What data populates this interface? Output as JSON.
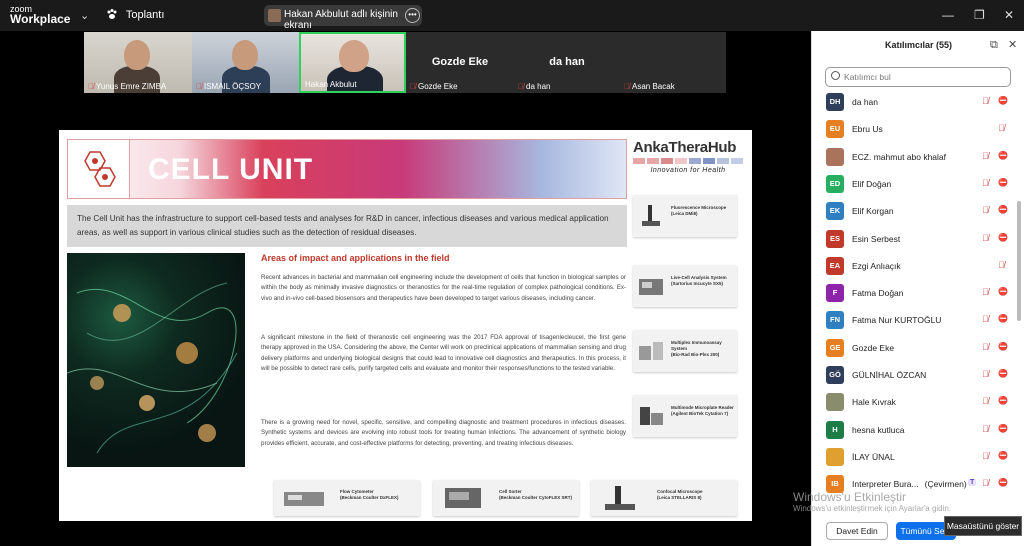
{
  "app": {
    "logo_top": "zoom",
    "logo_bottom": "Workplace",
    "meeting_label": "Toplantı"
  },
  "share": {
    "label": "Hakan Akbulut adlı kişinin ekranı"
  },
  "window_controls": {
    "minimize": "—",
    "restore": "❐",
    "close": "✕"
  },
  "video_tiles": [
    {
      "name": "Yunus Emre ZIMBA",
      "type": "camera"
    },
    {
      "name": "ISMAIL ÖÇSOY",
      "type": "camera"
    },
    {
      "name": "Hakan Akbulut",
      "type": "camera",
      "active_speaker": true
    },
    {
      "name": "Gozde Eke",
      "display": "Gozde Eke",
      "type": "name"
    },
    {
      "name": "da han",
      "display": "da han",
      "type": "name"
    },
    {
      "name": "Asan Bacak",
      "type": "name"
    }
  ],
  "slide": {
    "banner_title": "CELL UNIT",
    "brand_name": "AnkaTheraHub",
    "brand_tagline": "Innovation for Health",
    "intro": "The Cell Unit has the infrastructure to support cell-based tests and analyses for R&D in cancer, infectious diseases and various medical application areas, as well as support in various clinical studies such as the detection of residual diseases.",
    "areas_title": "Areas of impact and applications in the field",
    "para1": "Recent advances in bacterial and mammalian cell engineering include the development of cells that function in biological samples or within the body as minimally invasive diagnostics or theranostics for the real-time regulation of complex pathological conditions. Ex-vivo and in-vivo cell-based biosensors and therapeutics have been developed to target various diseases, including cancer.",
    "para2": "A significant milestone in the field of theranostic cell engineering was the 2017 FDA approval of tisagenlecleucel, the first gene therapy approved in the USA. Considering the above, the Center will work on preclinical applications of mammalian sensing and drug delivery platforms and underlying biological designs that could lead to innovative cell diagnostics and therapeutics. In this process, it will be possible to detect rare cells, purify targeted cells and evaluate and monitor their responses/functions to the tested variable.",
    "para3": "There is a growing need for novel, specific, sensitive, and compelling diagnostic and treatment procedures in infectious diseases. Synthetic systems and devices are evolving into robust tools for treating human infections. The advancement of synthetic biology provides efficient, accurate, and cost-effective platforms for detecting, preventing, and treating infectious diseases.",
    "equipment_side": [
      {
        "name": "Fluorescence Microscope",
        "model": "(Leica DMi8)"
      },
      {
        "name": "Live-Cell Analysis System",
        "model": "(Sartorius Incucyte SX5)"
      },
      {
        "name": "Multiplex Immunoassay System",
        "model": "(Bio-Rad Bio-Plex 200)"
      },
      {
        "name": "Multimode Microplate Reader",
        "model": "(Agilent BioTek Cytation 7)"
      }
    ],
    "equipment_bottom": [
      {
        "name": "Flow Cytometer",
        "model": "(Beckman Coulter DxFLEX)"
      },
      {
        "name": "Cell Sorter",
        "model": "(Beckman Coulter CytoFLEX SRT)"
      },
      {
        "name": "Confocal Microscope",
        "model": "(Leica STELLARIS 8)"
      }
    ]
  },
  "participants": {
    "title": "Katılımcılar (55)",
    "search_placeholder": "Katılımcı bul",
    "list": [
      {
        "initials": "DH",
        "name": "da han",
        "color": "#2f3e5a",
        "video_off": true
      },
      {
        "initials": "EU",
        "name": "Ebru Us",
        "color": "#e67e22",
        "video_off": false
      },
      {
        "initials": "",
        "name": "ECZ. mahmut abo khalaf",
        "color": "#a9745b",
        "photo": true,
        "video_off": true
      },
      {
        "initials": "ED",
        "name": "Elif Doğan",
        "color": "#27ae60",
        "video_off": true
      },
      {
        "initials": "EK",
        "name": "Elif Korgan",
        "color": "#2f7fc1",
        "video_off": true
      },
      {
        "initials": "ES",
        "name": "Esin Serbest",
        "color": "#c0392b",
        "video_off": true
      },
      {
        "initials": "EA",
        "name": "Ezgi Anlıaçık",
        "color": "#c0392b",
        "video_off": false
      },
      {
        "initials": "F",
        "name": "Fatma Doğan",
        "color": "#8e24aa",
        "video_off": true
      },
      {
        "initials": "FN",
        "name": "Fatma Nur KURTOĞLU",
        "color": "#2f7fc1",
        "video_off": true
      },
      {
        "initials": "GE",
        "name": "Gozde Eke",
        "color": "#e67e22",
        "video_off": true
      },
      {
        "initials": "GÖ",
        "name": "GÜLNİHAL ÖZCAN",
        "color": "#2f3e5a",
        "video_off": true
      },
      {
        "initials": "",
        "name": "Hale Kıvrak",
        "color": "#8a8d6b",
        "photo": true,
        "video_off": true
      },
      {
        "initials": "H",
        "name": "hesna kutluca",
        "color": "#1e7d46",
        "video_off": true
      },
      {
        "initials": "",
        "name": "İLAY ÜNAL",
        "color": "#e0a030",
        "photo": true,
        "video_off": true
      },
      {
        "initials": "IB",
        "name": "Interpreter Bura...",
        "suffix": "(Çevirmen)",
        "badge": "T",
        "color": "#e67e22",
        "video_off": true
      }
    ],
    "invite_label": "Davet Edin",
    "mute_label": "Tümünü Se..."
  },
  "tooltip": "Masaüstünü göster",
  "watermark": {
    "line1": "Windows'u Etkinleştir",
    "line2": "Windows'u etkinleştirmek için Ayarlar'a gidin."
  }
}
